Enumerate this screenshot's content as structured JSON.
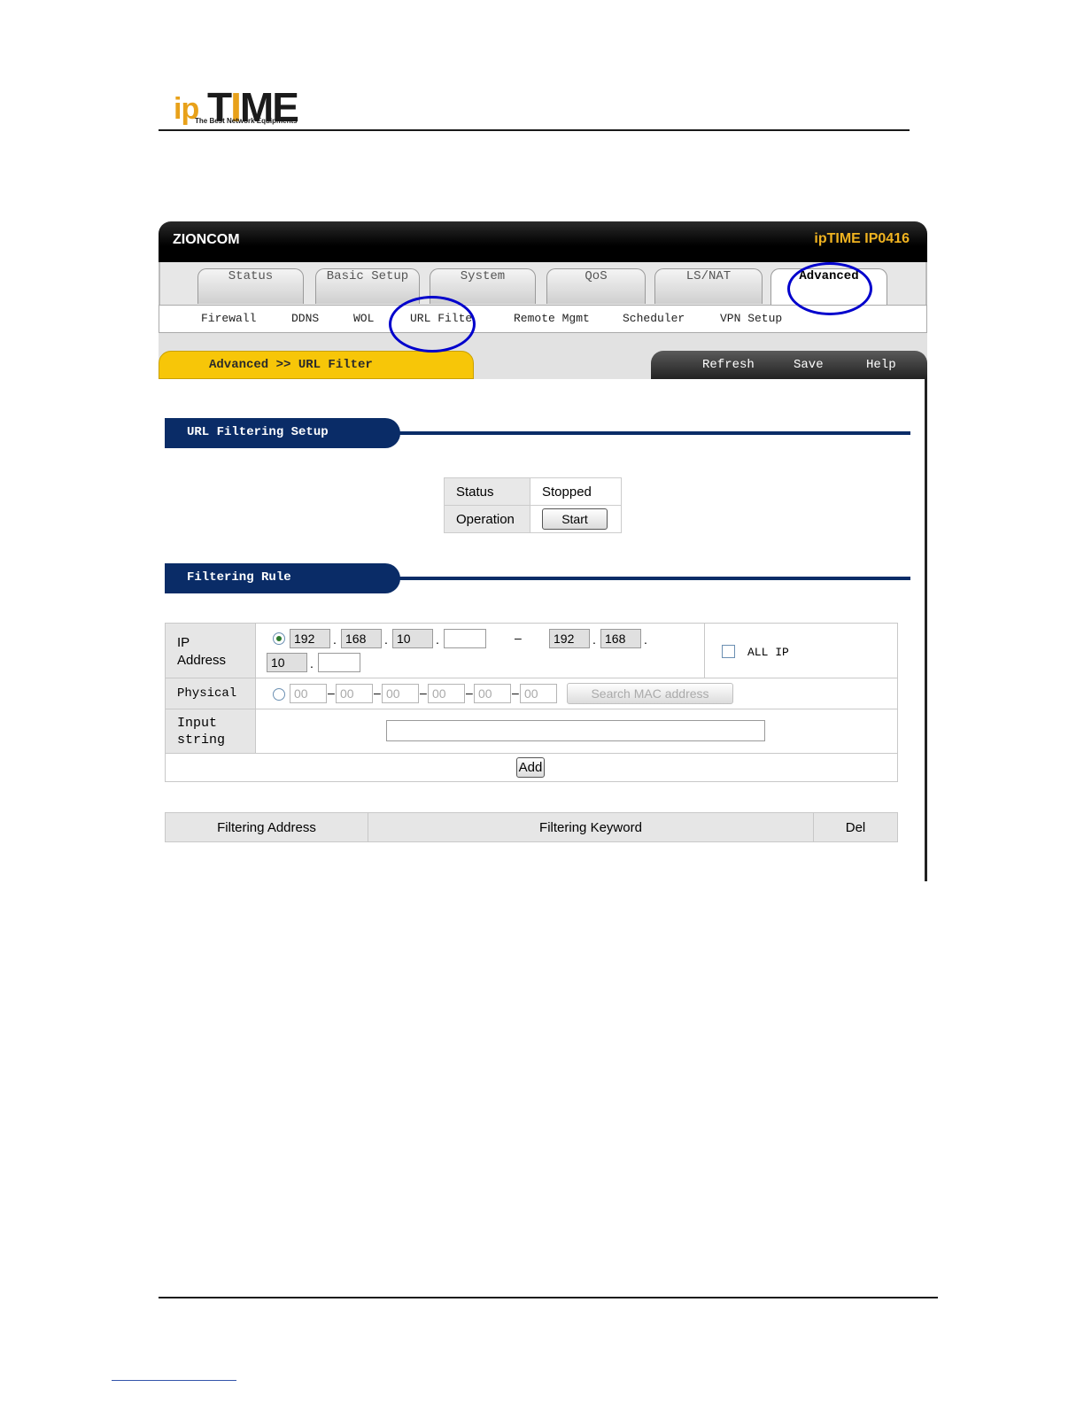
{
  "logo": {
    "ip": "ip",
    "time_a": "T",
    "time_b": "I",
    "time_c": "ME",
    "tagline": "The Best Network Equipments"
  },
  "app": {
    "brand": "ZIONCOM",
    "model": "ipTIME IP0416",
    "tabs": [
      {
        "label": "Status"
      },
      {
        "label": "Basic Setup"
      },
      {
        "label": "System"
      },
      {
        "label": "QoS"
      },
      {
        "label": "LS/NAT"
      },
      {
        "label": "Advanced",
        "active": true
      }
    ],
    "subnav": [
      "Firewall",
      "DDNS",
      "WOL",
      "URL Filter",
      "Remote Mgmt",
      "Scheduler",
      "VPN Setup"
    ],
    "breadcrumb": "Advanced >> URL Filter",
    "tools": [
      "Refresh",
      "Save",
      "Help"
    ]
  },
  "setup": {
    "title": "URL Filtering Setup",
    "status_label": "Status",
    "status_value": "Stopped",
    "operation_label": "Operation",
    "start_button": "Start"
  },
  "rule": {
    "title": "Filtering Rule",
    "ip_label_1": "IP",
    "ip_label_2": "Address",
    "ip_from": [
      "192",
      "168",
      "10",
      ""
    ],
    "ip_to": [
      "192",
      "168",
      "10",
      ""
    ],
    "range_sep": "–",
    "all_ip_label": "ALL IP",
    "physical_label": "Physical",
    "mac_placeholder": [
      "00",
      "00",
      "00",
      "00",
      "00",
      "00"
    ],
    "search_mac_button": "Search MAC address",
    "input_label_1": "Input",
    "input_label_2": "string",
    "input_value": "",
    "add_button": "Add"
  },
  "list": {
    "col_address": "Filtering Address",
    "col_keyword": "Filtering Keyword",
    "col_del": "Del"
  },
  "colors": {
    "navy": "#0a2c67",
    "gold": "#f7c608",
    "annotation": "#0000cc"
  }
}
